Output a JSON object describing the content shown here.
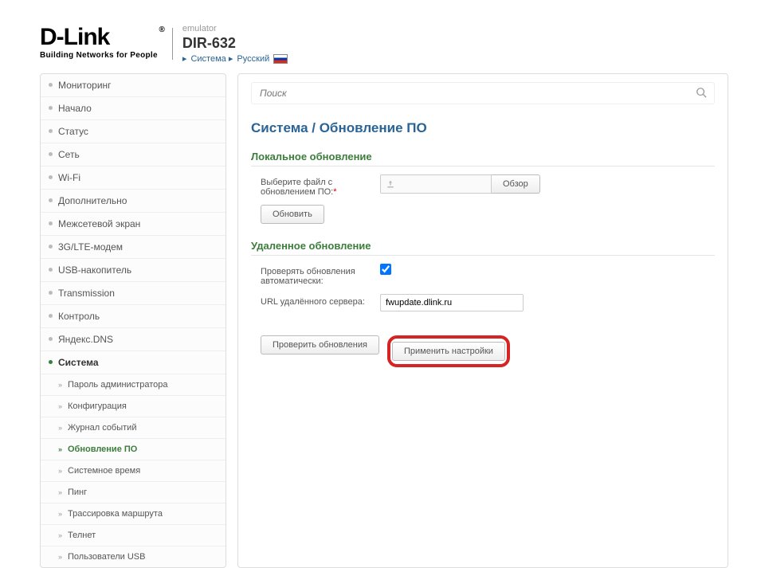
{
  "header": {
    "logo_title": "D-Link",
    "logo_subtitle": "Building Networks for People",
    "emulator": "emulator",
    "device": "DIR-632",
    "breadcrumb": {
      "system": "Система",
      "lang": "Русский"
    }
  },
  "search": {
    "placeholder": "Поиск"
  },
  "sidebar": {
    "items": [
      {
        "label": "Мониторинг"
      },
      {
        "label": "Начало"
      },
      {
        "label": "Статус"
      },
      {
        "label": "Сеть"
      },
      {
        "label": "Wi-Fi"
      },
      {
        "label": "Дополнительно"
      },
      {
        "label": "Межсетевой экран"
      },
      {
        "label": "3G/LTE-модем"
      },
      {
        "label": "USB-накопитель"
      },
      {
        "label": "Transmission"
      },
      {
        "label": "Контроль"
      },
      {
        "label": "Яндекс.DNS"
      },
      {
        "label": "Система",
        "active": true
      }
    ],
    "sub": [
      {
        "label": "Пароль администратора"
      },
      {
        "label": "Конфигурация"
      },
      {
        "label": "Журнал событий"
      },
      {
        "label": "Обновление ПО",
        "active": true
      },
      {
        "label": "Системное время"
      },
      {
        "label": "Пинг"
      },
      {
        "label": "Трассировка маршрута"
      },
      {
        "label": "Телнет"
      },
      {
        "label": "Пользователи USB"
      }
    ]
  },
  "main": {
    "title": "Система /  Обновление ПО",
    "local": {
      "heading": "Локальное обновление",
      "file_label": "Выберите файл с обновлением ПО:",
      "browse": "Обзор",
      "update": "Обновить"
    },
    "remote": {
      "heading": "Удаленное обновление",
      "auto_label": "Проверять обновления автоматически:",
      "url_label": "URL удалённого сервера:",
      "url_value": "fwupdate.dlink.ru"
    },
    "actions": {
      "check": "Проверить обновления",
      "apply": "Применить настройки"
    }
  }
}
